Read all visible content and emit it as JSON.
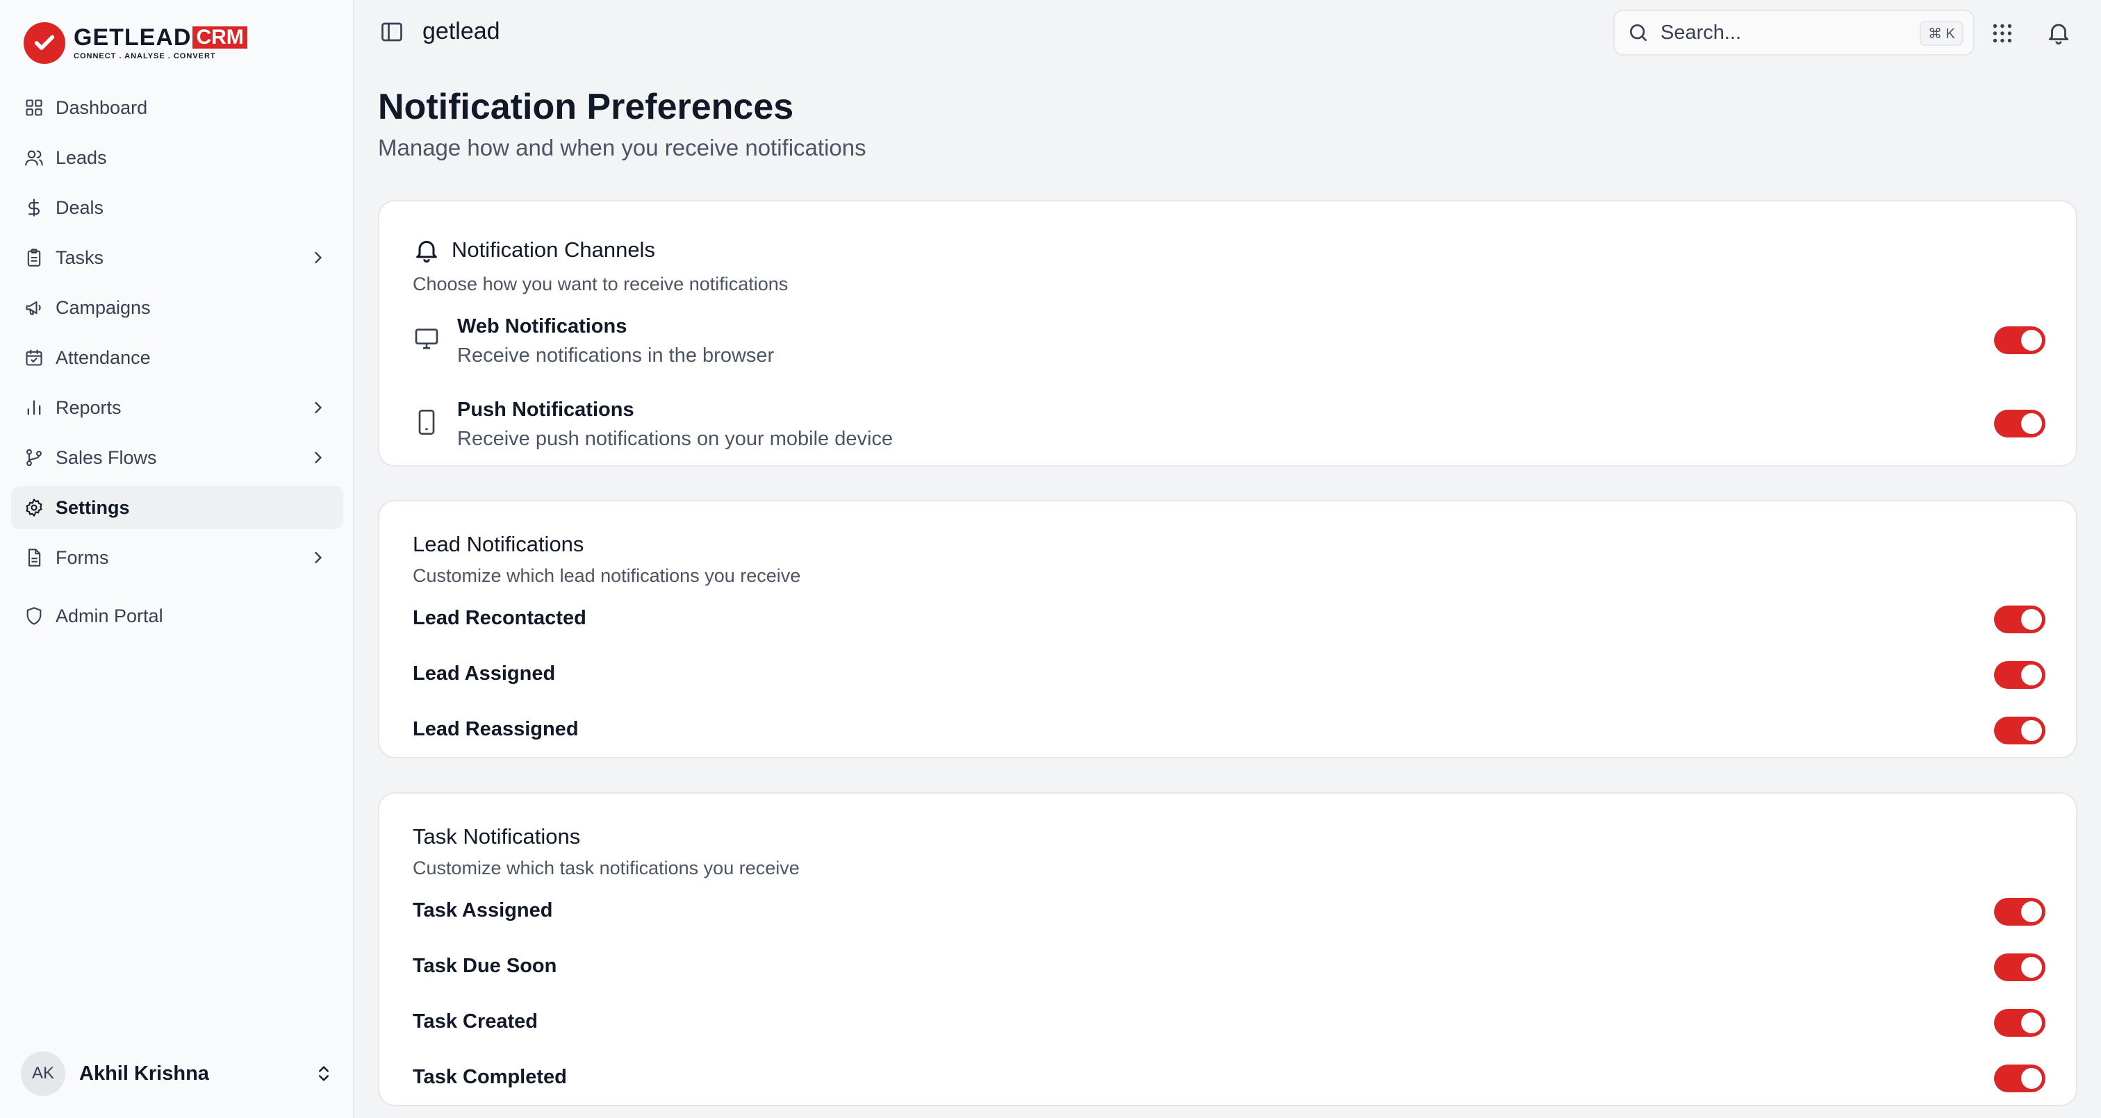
{
  "logo": {
    "word": "GETLEAD",
    "badge": "CRM",
    "tagline": "CONNECT  .  ANALYSE  .  CONVERT"
  },
  "sidebar": {
    "items": [
      {
        "label": "Dashboard",
        "icon": "dashboard-icon"
      },
      {
        "label": "Leads",
        "icon": "users-icon"
      },
      {
        "label": "Deals",
        "icon": "dollar-icon"
      },
      {
        "label": "Tasks",
        "icon": "clipboard-icon"
      },
      {
        "label": "Campaigns",
        "icon": "megaphone-icon"
      },
      {
        "label": "Attendance",
        "icon": "calendar-check-icon"
      },
      {
        "label": "Reports",
        "icon": "bar-chart-icon"
      },
      {
        "label": "Sales Flows",
        "icon": "git-branch-icon"
      },
      {
        "label": "Settings",
        "icon": "gear-icon"
      },
      {
        "label": "Forms",
        "icon": "file-text-icon"
      },
      {
        "label": "Admin Portal",
        "icon": "shield-icon"
      }
    ]
  },
  "user": {
    "initials": "AK",
    "name": "Akhil Krishna"
  },
  "header": {
    "brand": "getlead",
    "search_placeholder": "Search...",
    "shortcut": "⌘ K"
  },
  "page": {
    "title": "Notification Preferences",
    "subtitle": "Manage how and when you receive notifications"
  },
  "channels": {
    "title": "Notification Channels",
    "subtitle": "Choose how you want to receive notifications",
    "items": [
      {
        "title": "Web Notifications",
        "desc": "Receive notifications in the browser",
        "enabled": true
      },
      {
        "title": "Push Notifications",
        "desc": "Receive push notifications on your mobile device",
        "enabled": true
      }
    ]
  },
  "lead_notifications": {
    "title": "Lead Notifications",
    "subtitle": "Customize which lead notifications you receive",
    "items": [
      {
        "label": "Lead Recontacted",
        "enabled": true
      },
      {
        "label": "Lead Assigned",
        "enabled": true
      },
      {
        "label": "Lead Reassigned",
        "enabled": true
      }
    ]
  },
  "task_notifications": {
    "title": "Task Notifications",
    "subtitle": "Customize which task notifications you receive",
    "items": [
      {
        "label": "Task Assigned",
        "enabled": true
      },
      {
        "label": "Task Due Soon",
        "enabled": true
      },
      {
        "label": "Task Created",
        "enabled": true
      },
      {
        "label": "Task Completed",
        "enabled": true
      }
    ]
  },
  "colors": {
    "accent": "#dc2626",
    "background": "#f3f4f6",
    "sidebar": "#f9fafb"
  }
}
